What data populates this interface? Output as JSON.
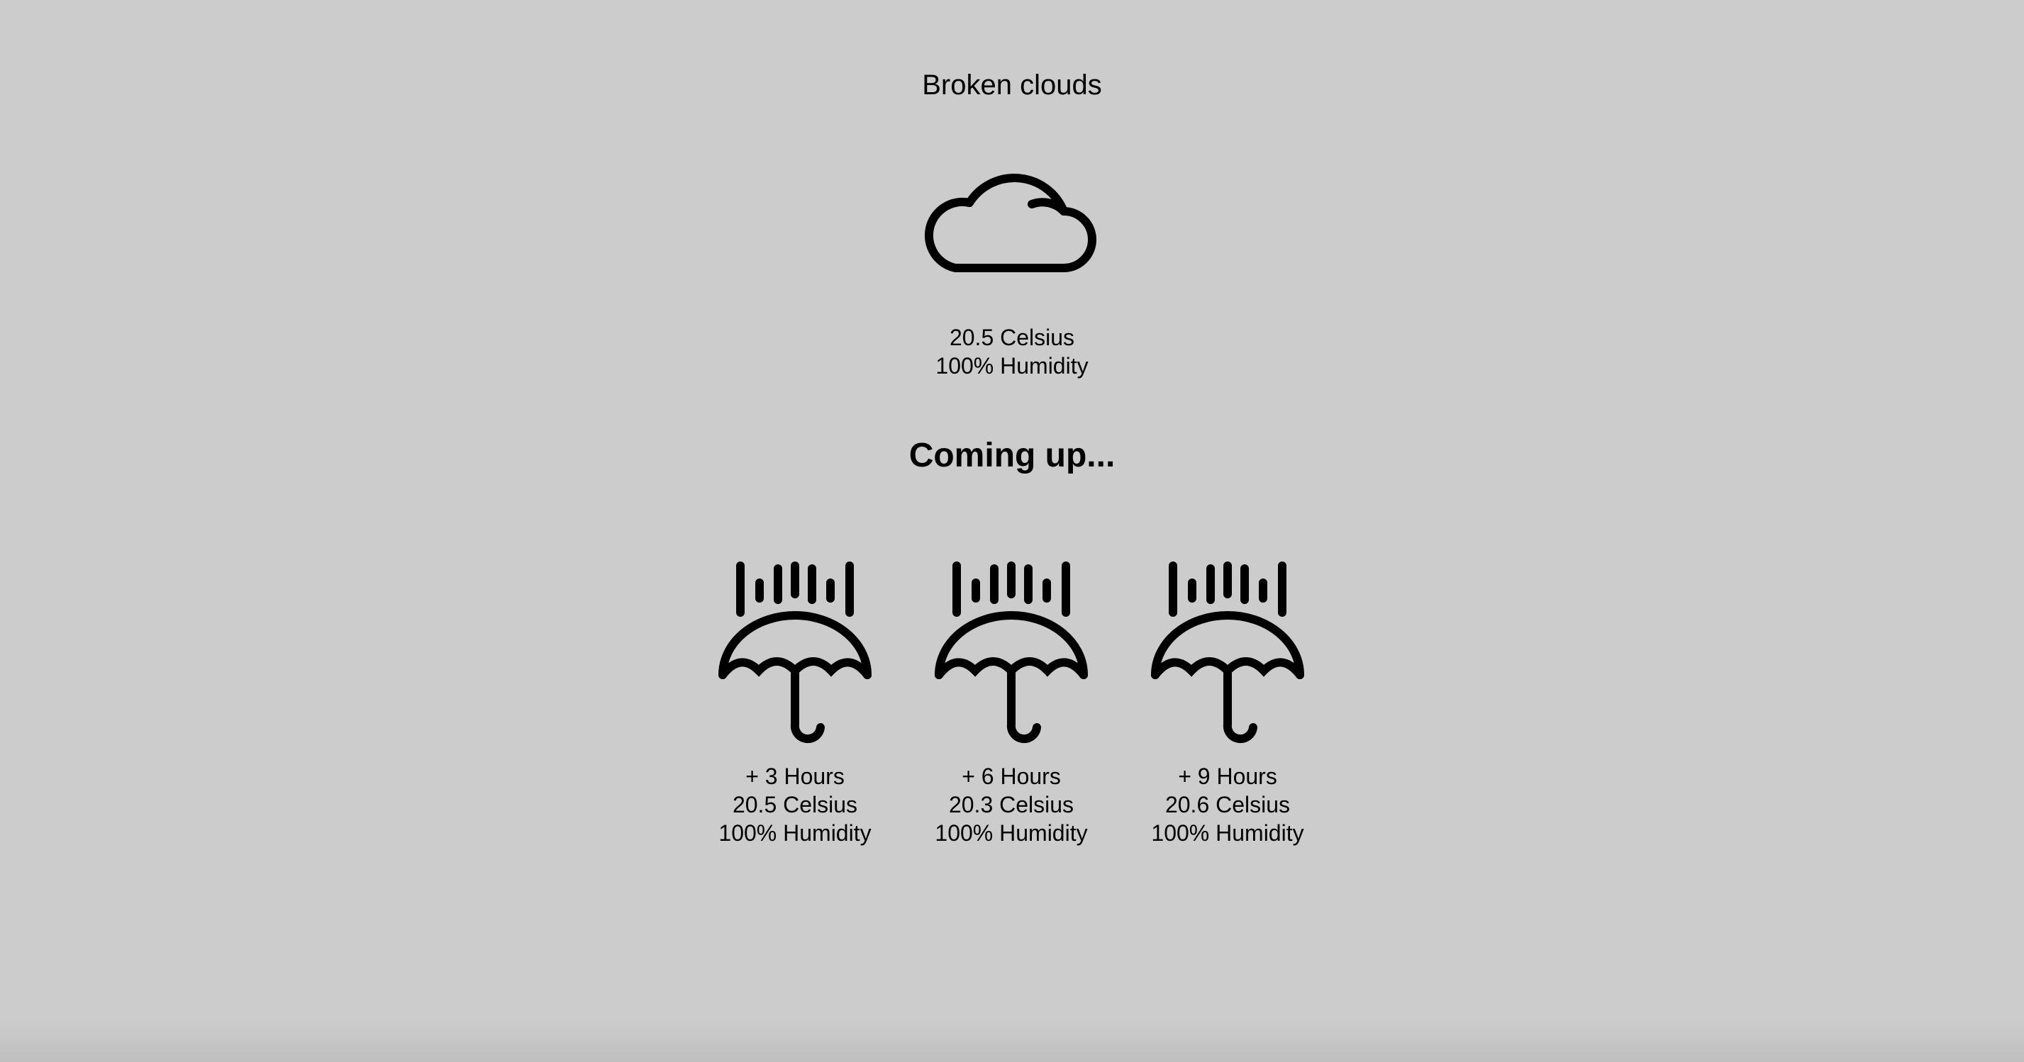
{
  "current": {
    "condition": "Broken clouds",
    "icon": "cloud-icon",
    "temperature": "20.5 Celsius",
    "humidity": "100% Humidity"
  },
  "forecast_heading": "Coming up...",
  "forecast": [
    {
      "offset": "+ 3 Hours",
      "temperature": "20.5 Celsius",
      "humidity": "100% Humidity",
      "icon": "umbrella-rain-icon"
    },
    {
      "offset": "+ 6 Hours",
      "temperature": "20.3 Celsius",
      "humidity": "100% Humidity",
      "icon": "umbrella-rain-icon"
    },
    {
      "offset": "+ 9 Hours",
      "temperature": "20.6 Celsius",
      "humidity": "100% Humidity",
      "icon": "umbrella-rain-icon"
    }
  ],
  "colors": {
    "background": "#cccccc",
    "foreground": "#000000"
  }
}
